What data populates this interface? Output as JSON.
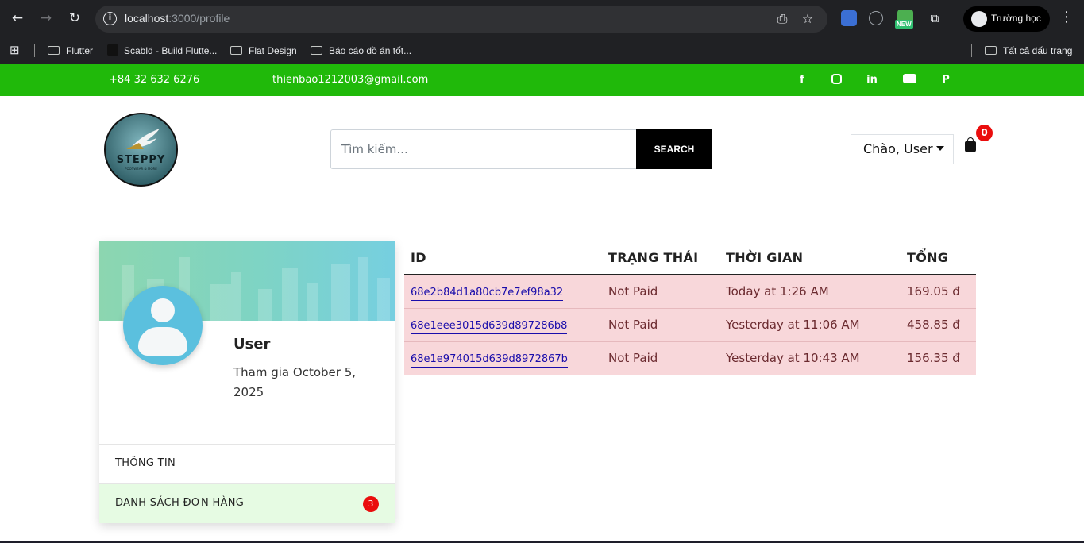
{
  "browser": {
    "url_host": "localhost",
    "url_path": ":3000/profile",
    "profile_label": "Trường học",
    "bookmarks": [
      "Flutter",
      "Scabld - Build Flutte...",
      "Flat Design",
      "Báo cáo đồ án tốt..."
    ],
    "bookmarks_right": "Tất cả dấu trang",
    "new_badge": "NEW"
  },
  "topbar": {
    "phone": "+84 32 632 6276",
    "email": "thienbao1212003@gmail.com",
    "social_icons": [
      "facebook-icon",
      "instagram-icon",
      "linkedin-icon",
      "youtube-icon",
      "pinterest-icon"
    ],
    "background": "#20b90a"
  },
  "header": {
    "logo_text": "STEPPY",
    "logo_sub": "FOOTWEAR & MORE",
    "search_placeholder": "Tìm kiếm...",
    "search_button": "SEARCH",
    "user_greeting": "Chào, User",
    "cart_count": "0"
  },
  "profile": {
    "name": "User",
    "joined": "Tham gia October 5, 2025",
    "menu": [
      {
        "label": "THÔNG TIN"
      },
      {
        "label": "DANH SÁCH ĐƠN HÀNG",
        "badge": "3"
      }
    ]
  },
  "orders": {
    "headers": [
      "ID",
      "TRẠNG THÁI",
      "THỜI GIAN",
      "TỔNG"
    ],
    "rows": [
      {
        "id": "68e2b84d1a80cb7e7ef98a32",
        "status": "Not Paid",
        "time": "Today at 1:26 AM",
        "total": "169.05 đ"
      },
      {
        "id": "68e1eee3015d639d897286b8",
        "status": "Not Paid",
        "time": "Yesterday at 11:06 AM",
        "total": "458.85 đ"
      },
      {
        "id": "68e1e974015d639d8972867b",
        "status": "Not Paid",
        "time": "Yesterday at 10:43 AM",
        "total": "156.35 đ"
      }
    ]
  }
}
